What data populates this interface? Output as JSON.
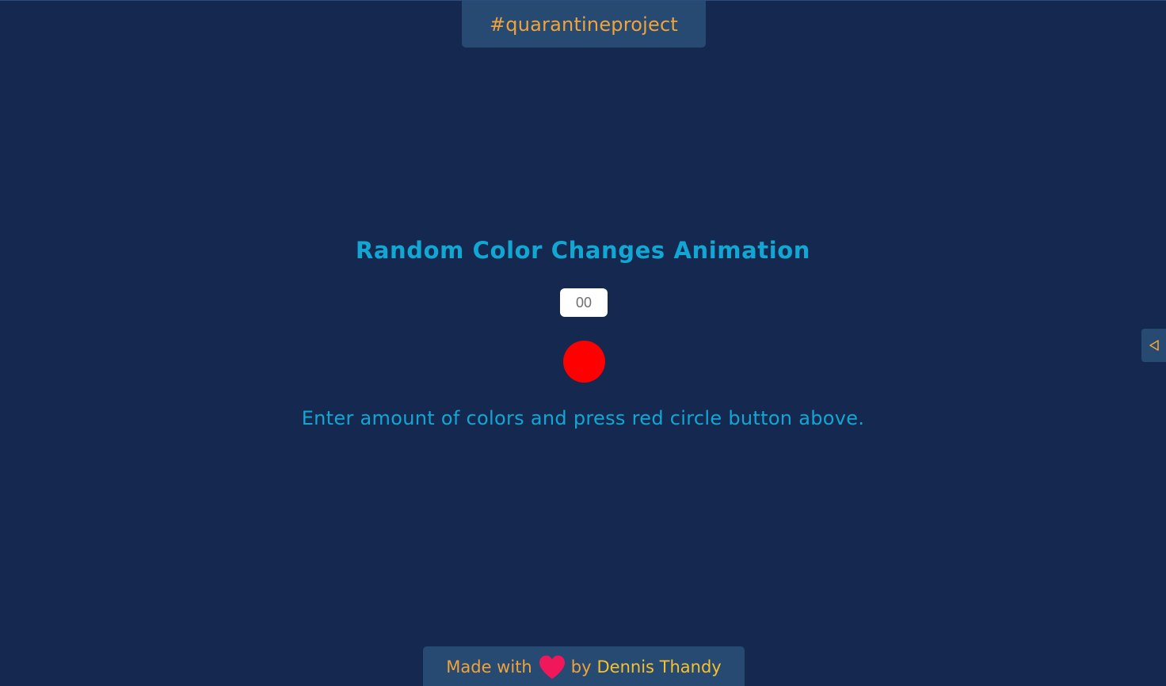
{
  "header": {
    "tag_link": "#quarantineproject"
  },
  "main": {
    "title": "Random Color Changes Animation",
    "input_placeholder": "00",
    "instruction": "Enter amount of colors and press red circle button above."
  },
  "side_toggle": {
    "icon": "triangle-left-icon"
  },
  "footer": {
    "made_with": "Made with",
    "heart_icon": "heart-icon",
    "by": "by",
    "author": "Dennis Thandy"
  },
  "colors": {
    "background": "#15284f",
    "panel": "#264a72",
    "accent_orange": "#f0a33a",
    "accent_yellow": "#f7c12b",
    "title_blue": "#12a7d3",
    "circle_red": "#ff0000",
    "heart_pink": "#f0185a"
  }
}
